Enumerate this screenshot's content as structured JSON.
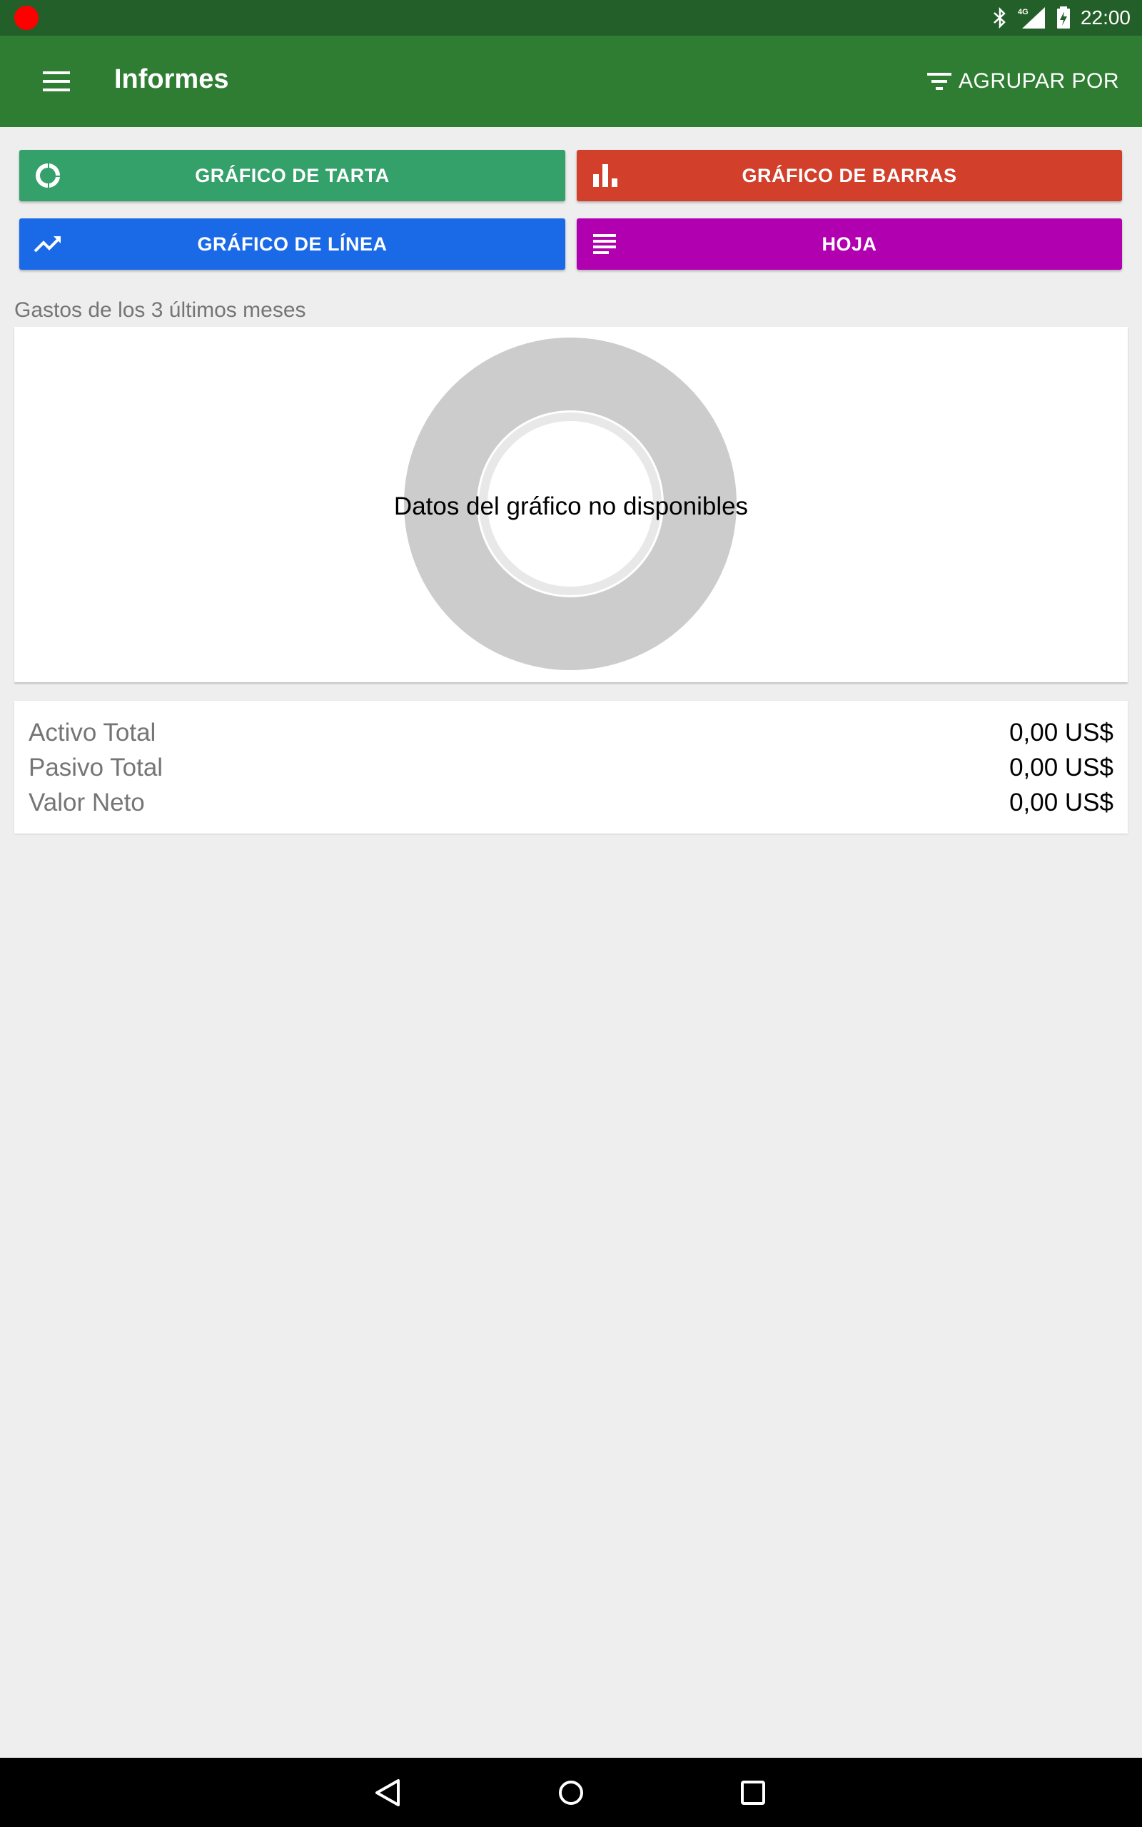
{
  "status_bar": {
    "time": "22:00",
    "icons": [
      "recording-dot-icon",
      "bluetooth-icon",
      "4g-icon",
      "signal-icon",
      "battery-charging-icon"
    ]
  },
  "app_bar": {
    "title": "Informes",
    "group_by_label": "AGRUPAR POR",
    "background": "#2e7d32"
  },
  "report_buttons": [
    {
      "label": "GRÁFICO DE TARTA",
      "icon": "pie-chart-icon",
      "color": "#34a06a"
    },
    {
      "label": "GRÁFICO DE BARRAS",
      "icon": "bar-chart-icon",
      "color": "#d23f2b"
    },
    {
      "label": "GRÁFICO DE LÍNEA",
      "icon": "line-chart-icon",
      "color": "#1a6ae8"
    },
    {
      "label": "HOJA",
      "icon": "sheet-icon",
      "color": "#b000b0"
    }
  ],
  "chart": {
    "section_title": "Gastos de los 3 últimos meses",
    "empty_message": "Datos del gráfico no disponibles"
  },
  "summary": [
    {
      "label": "Activo Total",
      "value": "0,00 US$"
    },
    {
      "label": "Pasivo Total",
      "value": "0,00 US$"
    },
    {
      "label": "Valor Neto",
      "value": "0,00 US$"
    }
  ],
  "nav_bar": {
    "icons": [
      "back-icon",
      "home-icon",
      "recents-icon"
    ]
  }
}
